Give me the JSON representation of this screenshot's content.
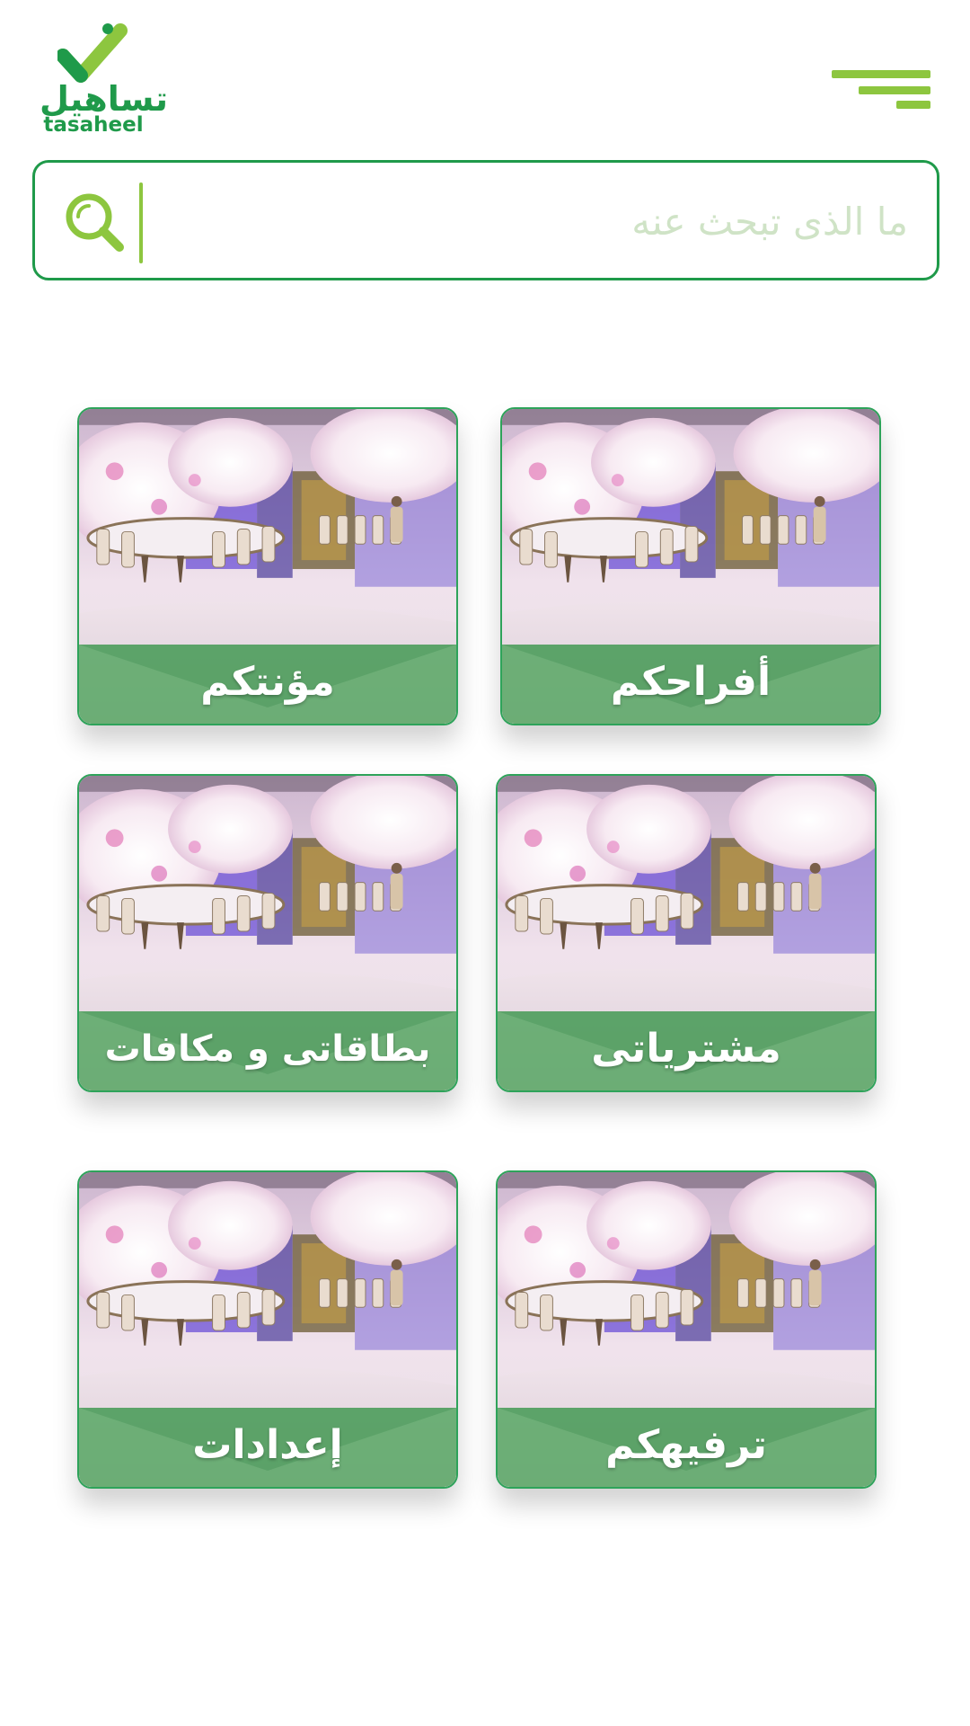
{
  "header": {
    "logo_arabic": "تساهيل",
    "logo_english": "tasaheel"
  },
  "search": {
    "placeholder": "ما الذى تبحث عنه"
  },
  "tiles": [
    {
      "label": "أفراحكم"
    },
    {
      "label": "مؤنتكم"
    },
    {
      "label": "مشترياتى"
    },
    {
      "label": "بطاقاتى و مكافات"
    },
    {
      "label": "ترفيهكم"
    },
    {
      "label": "إعدادات"
    }
  ],
  "colors": {
    "brand_green": "#1f9a4a",
    "accent_lime": "#8dc63f",
    "tile_band": "#5ca868"
  }
}
